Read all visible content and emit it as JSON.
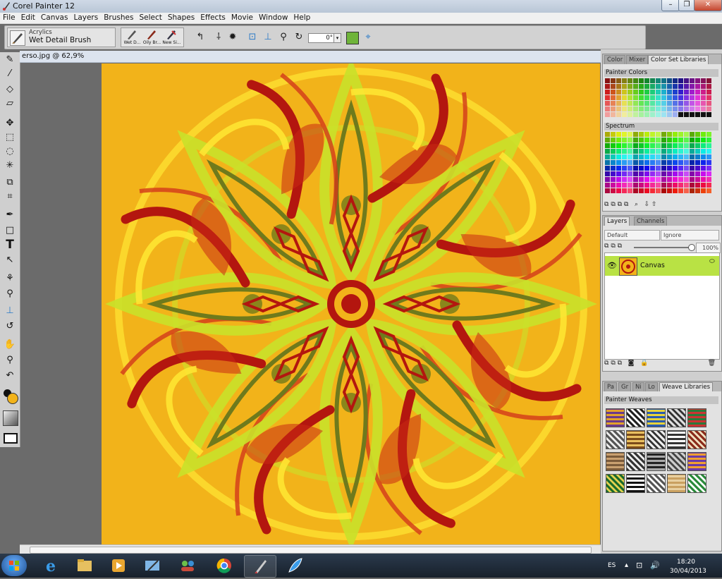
{
  "window": {
    "title": "Corel Painter 12",
    "controls": [
      "–",
      "❐",
      "✕"
    ]
  },
  "menu": [
    "File",
    "Edit",
    "Canvas",
    "Layers",
    "Brushes",
    "Select",
    "Shapes",
    "Effects",
    "Movie",
    "Window",
    "Help"
  ],
  "property_bar": {
    "brush_category": "Acrylics",
    "brush_variant": "Wet Detail Brush",
    "recent_brushes": [
      "Wet D...",
      "Oily Br...",
      "New Si..."
    ],
    "angle_value": "0°"
  },
  "document": {
    "title": "erso.jpg @ 62,9%"
  },
  "colors": {
    "canvas_bg": "#f2b31a",
    "accent_red": "#b3160f",
    "accent_lime": "#c9e12a",
    "accent_olive": "#6f7a1c",
    "layer_highlight": "#b9e244",
    "main_color": "#f2b31a"
  },
  "color_panel": {
    "tabs": [
      "Color",
      "Mixer",
      "Color Set Libraries"
    ],
    "sections": [
      "Painter Colors",
      "Spectrum"
    ]
  },
  "layers_panel": {
    "tabs": [
      "Layers",
      "Channels"
    ],
    "composite_method": "Default",
    "preserve_mode": "Ignore",
    "opacity": "100%",
    "layers": [
      {
        "name": "Canvas"
      }
    ]
  },
  "weave_panel": {
    "tabs": [
      "Pa",
      "Gr",
      "Ni",
      "Lo",
      "Weave Libraries"
    ],
    "section": "Painter Weaves"
  },
  "tray": {
    "lang": "ES",
    "time": "18:20",
    "date": "30/04/2013"
  }
}
